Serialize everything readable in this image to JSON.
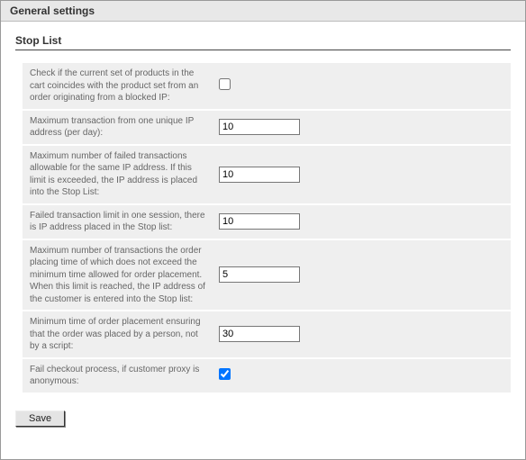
{
  "header": {
    "title": "General settings"
  },
  "section": {
    "title": "Stop List"
  },
  "rows": [
    {
      "label": "Check if the current set of products in the cart coincides with the product set from an order originating from a blocked IP:",
      "type": "checkbox",
      "checked": false
    },
    {
      "label": "Maximum transaction from one unique IP address (per day):",
      "type": "text",
      "value": "10"
    },
    {
      "label": "Maximum number of failed transactions allowable for the same IP address. If this limit is exceeded, the IP address is placed into the Stop List:",
      "type": "text",
      "value": "10"
    },
    {
      "label": "Failed transaction limit in one session, there is IP address placed in the Stop list:",
      "type": "text",
      "value": "10"
    },
    {
      "label": "Maximum number of transactions the order placing time of which does not exceed the minimum time allowed for order placement. When this limit is reached, the IP address of the customer is entered into the Stop list:",
      "type": "text",
      "value": "5"
    },
    {
      "label": "Minimum time of order placement ensuring that the order was placed by a person, not by a script:",
      "type": "text",
      "value": "30"
    },
    {
      "label": "Fail checkout process, if customer proxy is anonymous:",
      "type": "checkbox",
      "checked": true
    }
  ],
  "buttons": {
    "save": "Save"
  }
}
